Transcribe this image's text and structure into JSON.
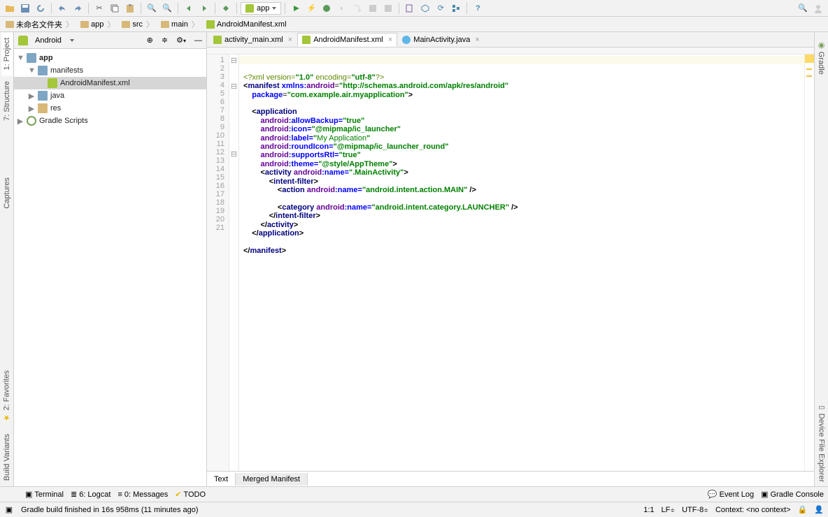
{
  "toolbar": {
    "run_config": "app"
  },
  "breadcrumbs": [
    "未命名文件夹",
    "app",
    "src",
    "main",
    "AndroidManifest.xml"
  ],
  "subbar": {
    "view": "Android"
  },
  "tree": {
    "root": "app",
    "manifests": "manifests",
    "manifest_file": "AndroidManifest.xml",
    "java": "java",
    "res": "res",
    "gradle": "Gradle Scripts"
  },
  "tabs": [
    {
      "label": "activity_main.xml",
      "type": "xml"
    },
    {
      "label": "AndroidManifest.xml",
      "type": "xml",
      "active": true
    },
    {
      "label": "MainActivity.java",
      "type": "java"
    }
  ],
  "code": {
    "lines": 21,
    "content": {
      "l1_a": "<?xml version=",
      "l1_b": "\"1.0\"",
      "l1_c": " encoding=",
      "l1_d": "\"utf-8\"",
      "l1_e": "?>",
      "l2_a": "<",
      "l2_b": "manifest ",
      "l2_c": "xmlns:",
      "l2_d": "android",
      "l2_e": "=",
      "l2_f": "\"http://schemas.android.com/apk/res/android\"",
      "l3_a": "package",
      "l3_b": "=",
      "l3_c": "\"com.example.air.myapplication\"",
      "l3_d": ">",
      "l5_a": "<",
      "l5_b": "application",
      "l6_a": "android",
      "l6_b": ":allowBackup=",
      "l6_c": "\"true\"",
      "l7_a": "android",
      "l7_b": ":icon=",
      "l7_c": "\"@mipmap/ic_launcher\"",
      "l8_a": "android",
      "l8_b": ":label=",
      "l8_c": "\"",
      "l8_d": "My Application",
      "l8_e": "\"",
      "l9_a": "android",
      "l9_b": ":roundIcon=",
      "l9_c": "\"@mipmap/ic_launcher_round\"",
      "l10_a": "android",
      "l10_b": ":supportsRtl=",
      "l10_c": "\"true\"",
      "l11_a": "android",
      "l11_b": ":theme=",
      "l11_c": "\"@style/AppTheme\"",
      "l11_d": ">",
      "l12_a": "<",
      "l12_b": "activity ",
      "l12_c": "android",
      "l12_d": ":name=",
      "l12_e": "\".MainActivity\"",
      "l12_f": ">",
      "l13_a": "<",
      "l13_b": "intent-filter",
      "l13_c": ">",
      "l14_a": "<",
      "l14_b": "action ",
      "l14_c": "android",
      "l14_d": ":name=",
      "l14_e": "\"android.intent.action.MAIN\"",
      "l14_f": " />",
      "l16_a": "<",
      "l16_b": "category ",
      "l16_c": "android",
      "l16_d": ":name=",
      "l16_e": "\"android.intent.category.LAUNCHER\"",
      "l16_f": " />",
      "l17_a": "</",
      "l17_b": "intent-filter",
      "l17_c": ">",
      "l18_a": "</",
      "l18_b": "activity",
      "l18_c": ">",
      "l19_a": "</",
      "l19_b": "application",
      "l19_c": ">",
      "l21_a": "</",
      "l21_b": "manifest",
      "l21_c": ">"
    }
  },
  "editor_bottom": {
    "text": "Text",
    "merged": "Merged Manifest"
  },
  "statusbar": {
    "terminal": "Terminal",
    "logcat": "6: Logcat",
    "messages": "0: Messages",
    "todo": "TODO",
    "eventlog": "Event Log",
    "gradle": "Gradle Console"
  },
  "footer": {
    "msg": "Gradle build finished in 16s 958ms (11 minutes ago)",
    "pos": "1:1",
    "lf": "LF",
    "enc": "UTF-8",
    "ctx": "Context: <no context>"
  },
  "left_rail": [
    "1: Project",
    "7: Structure",
    "Captures",
    "2: Favorites",
    "Build Variants"
  ],
  "right_rail": [
    "Gradle",
    "Device File Explorer"
  ]
}
